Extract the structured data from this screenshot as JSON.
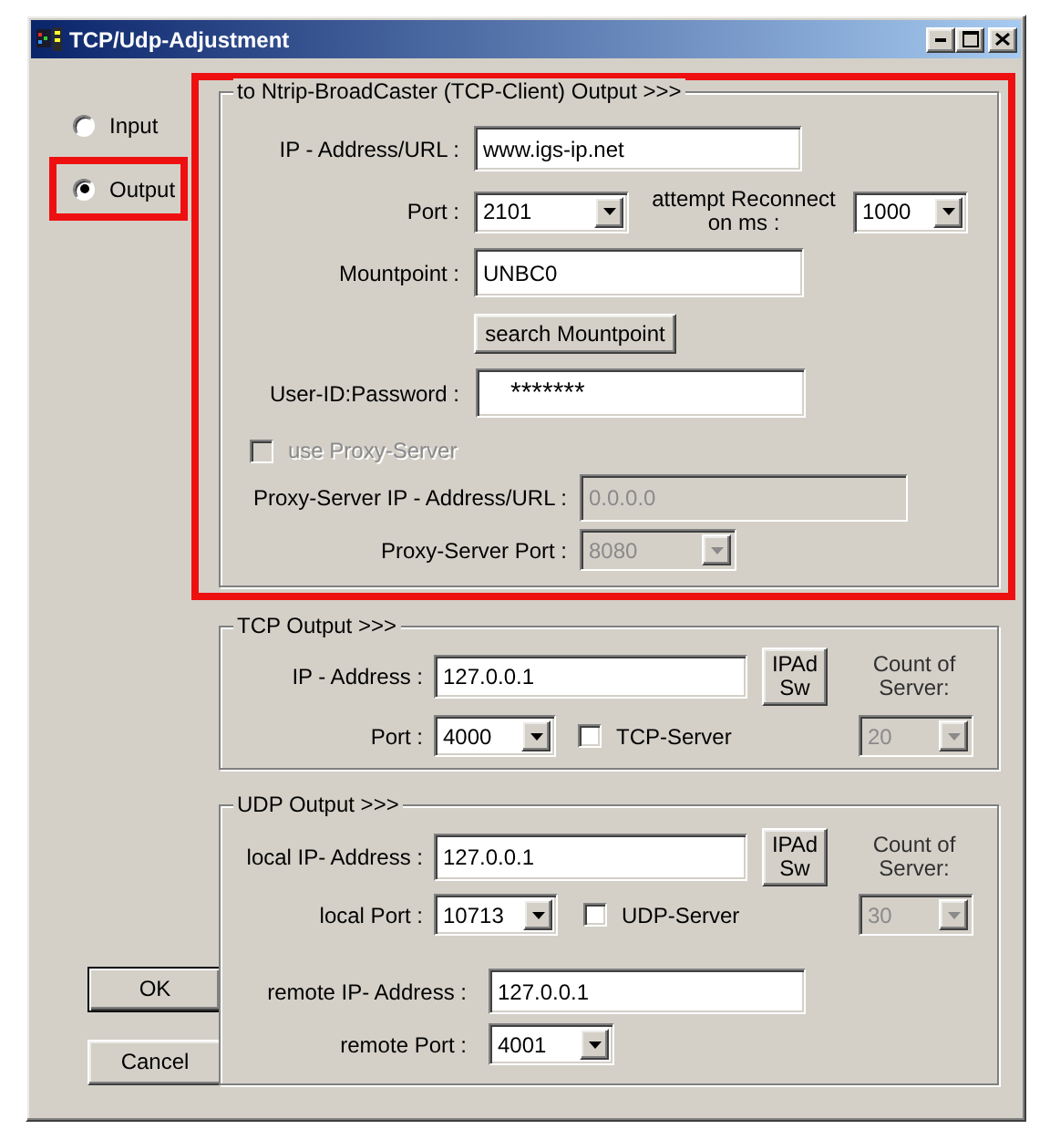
{
  "window": {
    "title": "TCP/Udp-Adjustment"
  },
  "mode_options": [
    {
      "label": "Input",
      "selected": false,
      "highlighted": false
    },
    {
      "label": "Output",
      "selected": true,
      "highlighted": true
    }
  ],
  "ntrip_output": {
    "title": "to Ntrip-BroadCaster (TCP-Client) Output >>>",
    "highlighted": true,
    "ip_url": {
      "label": "IP - Address/URL :",
      "value": "www.igs-ip.net"
    },
    "port": {
      "label": "Port :",
      "value": "2101"
    },
    "reconnect": {
      "label": "attempt Reconnect on ms :",
      "value": "1000"
    },
    "mountpoint": {
      "label": "Mountpoint :",
      "value": "UNBC0"
    },
    "search_button": "search Mountpoint",
    "user_password": {
      "label": "User-ID:Password :",
      "value": "*******"
    },
    "proxy": {
      "label": "use Proxy-Server",
      "checked": false,
      "disabled": true,
      "ip_url": {
        "label": "Proxy-Server IP - Address/URL :",
        "value": "0.0.0.0"
      },
      "port": {
        "label": "Proxy-Server Port :",
        "value": "8080"
      }
    }
  },
  "tcp_output": {
    "title": "TCP Output >>>",
    "ip": {
      "label": "IP - Address :",
      "value": "127.0.0.1"
    },
    "ipad_button": "IPAd Sw",
    "count": {
      "label": "Count of Server:",
      "value": "20",
      "disabled": true
    },
    "port": {
      "label": "Port :",
      "value": "4000"
    },
    "server": {
      "label": "TCP-Server",
      "checked": false
    }
  },
  "udp_output": {
    "title": "UDP Output >>>",
    "local_ip": {
      "label": "local IP- Address :",
      "value": "127.0.0.1"
    },
    "ipad_button": "IPAd Sw",
    "count": {
      "label": "Count of Server:",
      "value": "30",
      "disabled": true
    },
    "local_port": {
      "label": "local Port :",
      "value": "10713"
    },
    "server": {
      "label": "UDP-Server",
      "checked": false
    },
    "remote_ip": {
      "label": "remote IP- Address :",
      "value": "127.0.0.1"
    },
    "remote_port": {
      "label": "remote Port :",
      "value": "4001"
    }
  },
  "buttons": [
    {
      "label": "OK",
      "default": true
    },
    {
      "label": "Cancel",
      "default": false
    }
  ]
}
